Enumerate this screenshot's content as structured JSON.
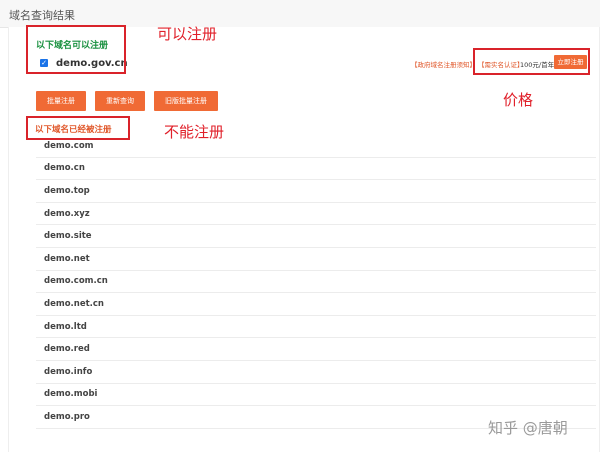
{
  "header": {
    "title": "域名查询结果"
  },
  "available": {
    "heading": "以下域名可以注册",
    "domain": "demo.gov.cn",
    "checked": true,
    "gov_note": "【政府域名注册须知】",
    "verify_note": "【需实名认证】",
    "price": "100元/首年",
    "register_label": "立即注册"
  },
  "buttons": {
    "batch": "批量注册",
    "requery": "重新查询",
    "legacy_batch": "旧版批量注册"
  },
  "taken": {
    "heading": "以下域名已经被注册",
    "domains": [
      "demo.com",
      "demo.cn",
      "demo.top",
      "demo.xyz",
      "demo.site",
      "demo.net",
      "demo.com.cn",
      "demo.net.cn",
      "demo.ltd",
      "demo.red",
      "demo.info",
      "demo.mobi",
      "demo.pro"
    ]
  },
  "annotations": {
    "can_register": "可以注册",
    "price": "价格",
    "cannot_register": "不能注册"
  },
  "watermark": "知乎 @唐朝",
  "colors": {
    "accent": "#f06a35",
    "available_green": "#1a9140",
    "annotation_red": "#e0202a"
  }
}
